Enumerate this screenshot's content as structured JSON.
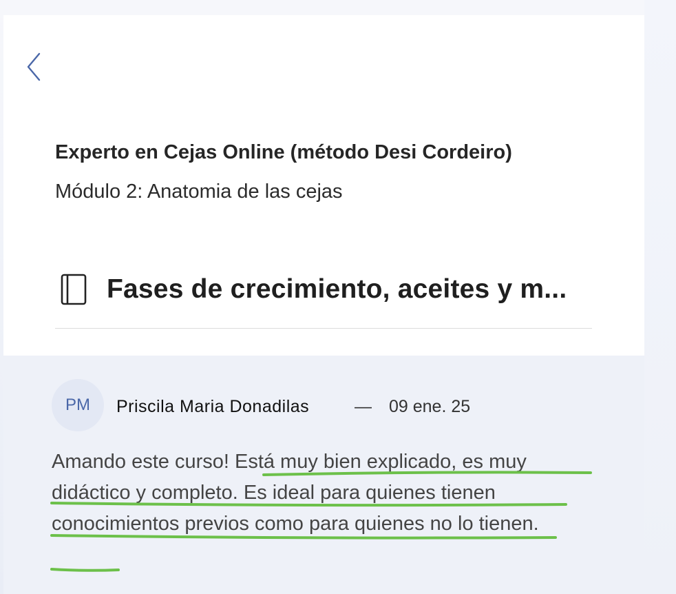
{
  "navigation": {
    "back_icon": "chevron-left-icon"
  },
  "course": {
    "title": "Experto en Cejas Online (método Desi Cordeiro)",
    "module": "Módulo 2: Anatomia de las cejas"
  },
  "lesson": {
    "icon": "book-icon",
    "title": "Fases de crecimiento, aceites y m..."
  },
  "comment": {
    "avatar_initials": "PM",
    "author": "Priscila Maria Donadilas",
    "separator": "—",
    "date": "09 ene. 25",
    "text": "Amando este curso! Está muy bien explicado, es muy didáctico y completo. Es ideal para quienes tienen conocimientos previos como para quienes no lo tienen."
  },
  "colors": {
    "accent": "#4a67a8",
    "highlight": "#6cc04a",
    "comment_bg": "#eef1f8"
  }
}
